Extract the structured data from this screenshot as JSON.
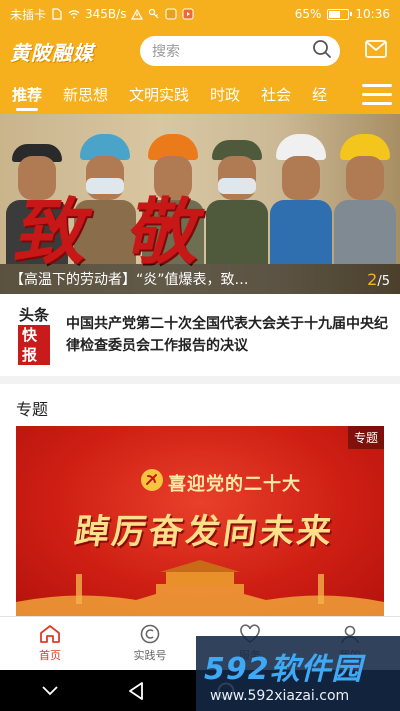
{
  "status_bar": {
    "carrier": "未插卡",
    "speed": "345B/s",
    "battery_percent": "65%",
    "battery_level": 0.65,
    "time": "10:36"
  },
  "header": {
    "logo": "黄陂融媒",
    "search_placeholder": "搜索",
    "mail_icon": "mail-icon"
  },
  "tabs": {
    "items": [
      "推荐",
      "新思想",
      "文明实践",
      "时政",
      "社会",
      "经"
    ],
    "active_index": 0
  },
  "banner": {
    "caption": "【高温下的劳动者】“炎”值爆表，致…",
    "brush_text": "致敬",
    "counter_current": "2",
    "counter_total": "/5"
  },
  "headline": {
    "badge_top": "头条",
    "badge_bottom": "快报",
    "text": "中国共产党第二十次全国代表大会关于十九届中央纪律检查委员会工作报告的决议"
  },
  "topics": {
    "title": "专题",
    "card_tag": "专题",
    "card_line1": "喜迎党的二十大",
    "card_line2": "踔厉奋发向未来"
  },
  "bottom_nav": {
    "items": [
      {
        "label": "首页",
        "icon": "home-icon"
      },
      {
        "label": "实践号",
        "icon": "practice-icon"
      },
      {
        "label": "服务",
        "icon": "heart-icon"
      },
      {
        "label": "我的",
        "icon": "profile-icon"
      }
    ],
    "active_index": 0
  },
  "watermark": {
    "brand": "592软件园",
    "url": "www.592xiazai.com"
  },
  "colors": {
    "brand": "#f6b01e",
    "accent_red": "#e03a2a"
  }
}
